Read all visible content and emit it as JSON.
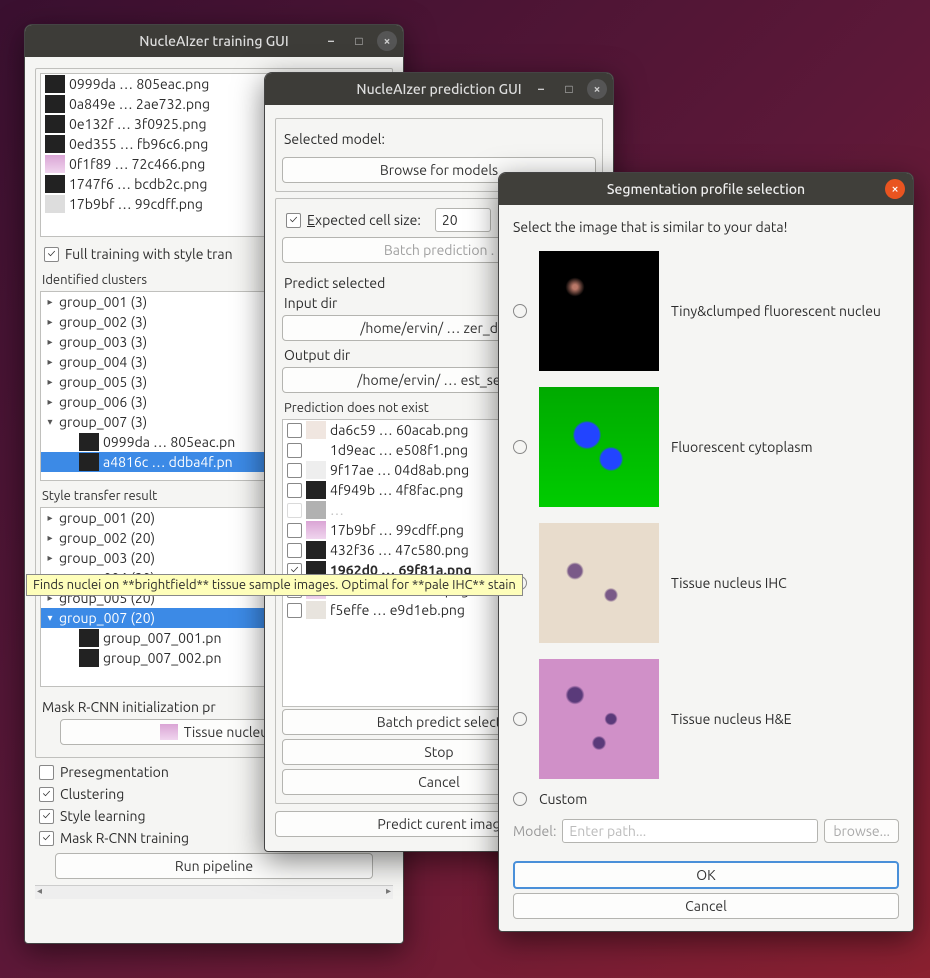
{
  "training": {
    "title": "NucleAIzer training GUI",
    "files": [
      "0999da … 805eac.png",
      "0a849e … 2ae732.png",
      "0e132f … 3f0925.png",
      "0ed355 … fb96c6.png",
      "0f1f89 … 72c466.png",
      "1747f6 … bcdb2c.png",
      "17b9bf … 99cdff.png"
    ],
    "full_training_label": "Full training with style tran",
    "clusters_title": "Identified clusters",
    "clusters": [
      "group_001 (3)",
      "group_002 (3)",
      "group_003 (3)",
      "group_004 (3)",
      "group_005 (3)",
      "group_006 (3)",
      "group_007 (3)"
    ],
    "cluster_children": [
      "0999da … 805eac.pn",
      "a4816c … ddba4f.pn"
    ],
    "style_title": "Style transfer result",
    "style_groups": [
      "group_001 (20)",
      "group_002 (20)",
      "group_003 (20)",
      "group_004 (20)",
      "group_005 (20)",
      "group_007 (20)"
    ],
    "style_children": [
      "group_007_001.pn",
      "group_007_002.pn"
    ],
    "mask_init_label": "Mask R-CNN initialization pr",
    "tissue_btn": "Tissue nucleu",
    "opt_preseg": "Presegmentation",
    "opt_cluster": "Clustering",
    "opt_style": "Style learning",
    "opt_mask": "Mask R-CNN training",
    "run_btn": "Run pipeline"
  },
  "prediction": {
    "title": "NucleAIzer prediction GUI",
    "model_label": "Selected model:",
    "browse_btn": "Browse for models",
    "exp_label_pre": "E",
    "exp_label_rest": "xpected cell size:",
    "exp_value": "20",
    "batch_all": "Batch prediction .",
    "predict_selected": "Predict selected",
    "input_dir_lbl": "Input dir",
    "input_dir": "/home/ervin/ … zer_data",
    "output_dir_lbl": "Output dir",
    "output_dir": "/home/ervin/ … est_segm",
    "notexist_title": "Prediction does not exist",
    "files": [
      "da6c59 … 60acab.png",
      "1d9eac … e508f1.png",
      "9f17ae … 04d8ab.png",
      "4f949b … 4f8fac.png",
      "17b9bf … 99cdff.png",
      "432f36 … 47c580.png",
      "1962d0 … 69f81a.png",
      "472b1c … c91c71.png",
      "f5effe … e9d1eb.png"
    ],
    "batch_sel": "Batch predict select",
    "stop": "Stop",
    "cancel": "Cancel",
    "predict_cur": "Predict curent imag"
  },
  "profile": {
    "title": "Segmentation profile selection",
    "prompt": "Select the image that is similar to your data!",
    "opts": [
      "Tiny&clumped fluorescent nucleu",
      "Fluorescent cytoplasm",
      "Tissue nucleus IHC",
      "Tissue nucleus H&E",
      "Custom"
    ],
    "model_label": "Model:",
    "model_placeholder": "Enter path...",
    "browse": "browse...",
    "ok": "OK",
    "cancel": "Cancel"
  },
  "tooltip": "Finds nuclei on **brightfield** tissue sample images. Optimal for **pale IHC** stain"
}
